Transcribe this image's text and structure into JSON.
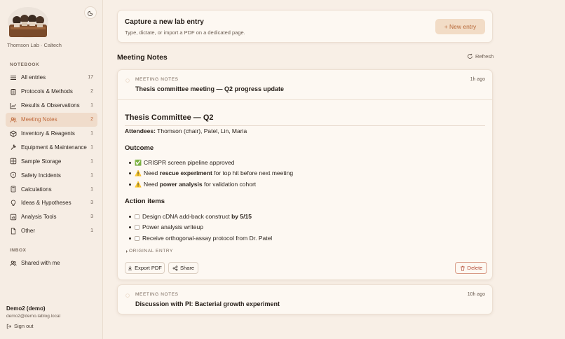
{
  "sidebar": {
    "lab_name": "Thomson Lab · Caltech",
    "notebook_label": "NOTEBOOK",
    "items": [
      {
        "label": "All entries",
        "count": "17",
        "icon": "list-icon"
      },
      {
        "label": "Protocols & Methods",
        "count": "2",
        "icon": "clipboard-icon"
      },
      {
        "label": "Results & Observations",
        "count": "1",
        "icon": "chart-line-icon"
      },
      {
        "label": "Meeting Notes",
        "count": "2",
        "icon": "users-icon",
        "active": true
      },
      {
        "label": "Inventory & Reagents",
        "count": "1",
        "icon": "box-icon"
      },
      {
        "label": "Equipment & Maintenance",
        "count": "1",
        "icon": "wrench-icon"
      },
      {
        "label": "Sample Storage",
        "count": "1",
        "icon": "grid-icon"
      },
      {
        "label": "Safety Incidents",
        "count": "1",
        "icon": "shield-icon"
      },
      {
        "label": "Calculations",
        "count": "1",
        "icon": "calculator-icon"
      },
      {
        "label": "Ideas & Hypotheses",
        "count": "3",
        "icon": "lightbulb-icon"
      },
      {
        "label": "Analysis Tools",
        "count": "3",
        "icon": "chart-bar-icon"
      },
      {
        "label": "Other",
        "count": "1",
        "icon": "file-icon"
      }
    ],
    "inbox_label": "INBOX",
    "inbox_items": [
      {
        "label": "Shared with me",
        "icon": "users-icon"
      }
    ],
    "user_name": "Demo2 (demo)",
    "user_email": "demo2@demo.lablog.local",
    "sign_out": "Sign out"
  },
  "capture": {
    "title": "Capture a new lab entry",
    "subtitle": "Type, dictate, or import a PDF on a dedicated page.",
    "new_entry_label": "+ New entry"
  },
  "section": {
    "title": "Meeting Notes",
    "refresh_label": "Refresh"
  },
  "notes": [
    {
      "kicker": "MEETING NOTES",
      "time": "1h ago",
      "title": "Thesis committee meeting — Q2 progress update",
      "doc": {
        "heading": "Thesis Committee — Q2",
        "attendees_label": "Attendees:",
        "attendees": "Thomson (chair), Patel, Lin, Maria",
        "outcome_heading": "Outcome",
        "outcome": [
          {
            "emoji": "✅",
            "pre": "CRISPR screen pipeline approved",
            "bold": "",
            "post": ""
          },
          {
            "emoji": "⚠️",
            "pre": "Need ",
            "bold": "rescue experiment",
            "post": " for top hit before next meeting"
          },
          {
            "emoji": "⚠️",
            "pre": "Need ",
            "bold": "power analysis",
            "post": " for validation cohort"
          }
        ],
        "actions_heading": "Action items",
        "actions": [
          {
            "pre": "Design cDNA add-back construct ",
            "bold": "by 5/15"
          },
          {
            "pre": "Power analysis writeup",
            "bold": ""
          },
          {
            "pre": "Receive orthogonal-assay protocol from Dr. Patel",
            "bold": ""
          }
        ],
        "original_entry": "ORIGINAL ENTRY"
      },
      "export_label": "Export PDF",
      "share_label": "Share",
      "delete_label": "Delete"
    },
    {
      "kicker": "MEETING NOTES",
      "time": "10h ago",
      "title": "Discussion with PI: Bacterial growth experiment"
    }
  ],
  "colors": {
    "accent": "#c06a3c",
    "background": "#f8efe6",
    "card": "#fdf8f2",
    "delete": "#b24a34"
  }
}
